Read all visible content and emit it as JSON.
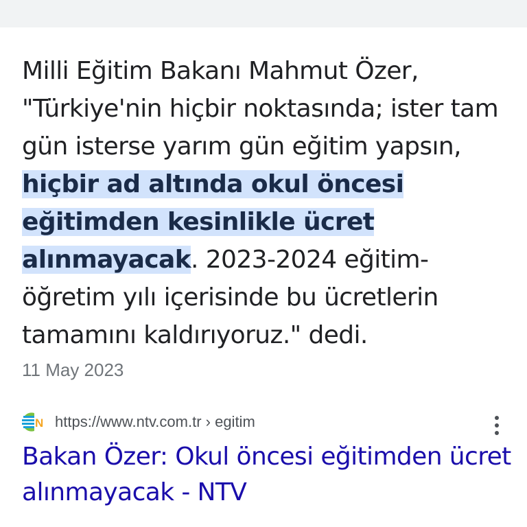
{
  "snippet": {
    "text_before": "Milli Eğitim Bakanı Mahmut Özer, \"Türkiye'nin hiçbir noktasında; ister tam gün isterse yarım gün eğitim yapsın, ",
    "highlight": "hiçbir ad altında okul öncesi eğitimden kesinlikle ücret alınmayacak",
    "text_after": ". 2023-2024 eğitim-öğretim yılı içerisinde bu ücretlerin tamamını kaldırıyoruz.\" dedi."
  },
  "date": "11 May 2023",
  "source": {
    "icon": "ntv-logo-icon",
    "url": "https://www.ntv.com.tr › egitim"
  },
  "result_title": "Bakan Özer: Okul öncesi eğitimden ücret alınmayacak - NTV",
  "colors": {
    "highlight_bg": "#d2e3fc",
    "link": "#1a0dab",
    "text": "#202124",
    "muted": "#70757a"
  }
}
